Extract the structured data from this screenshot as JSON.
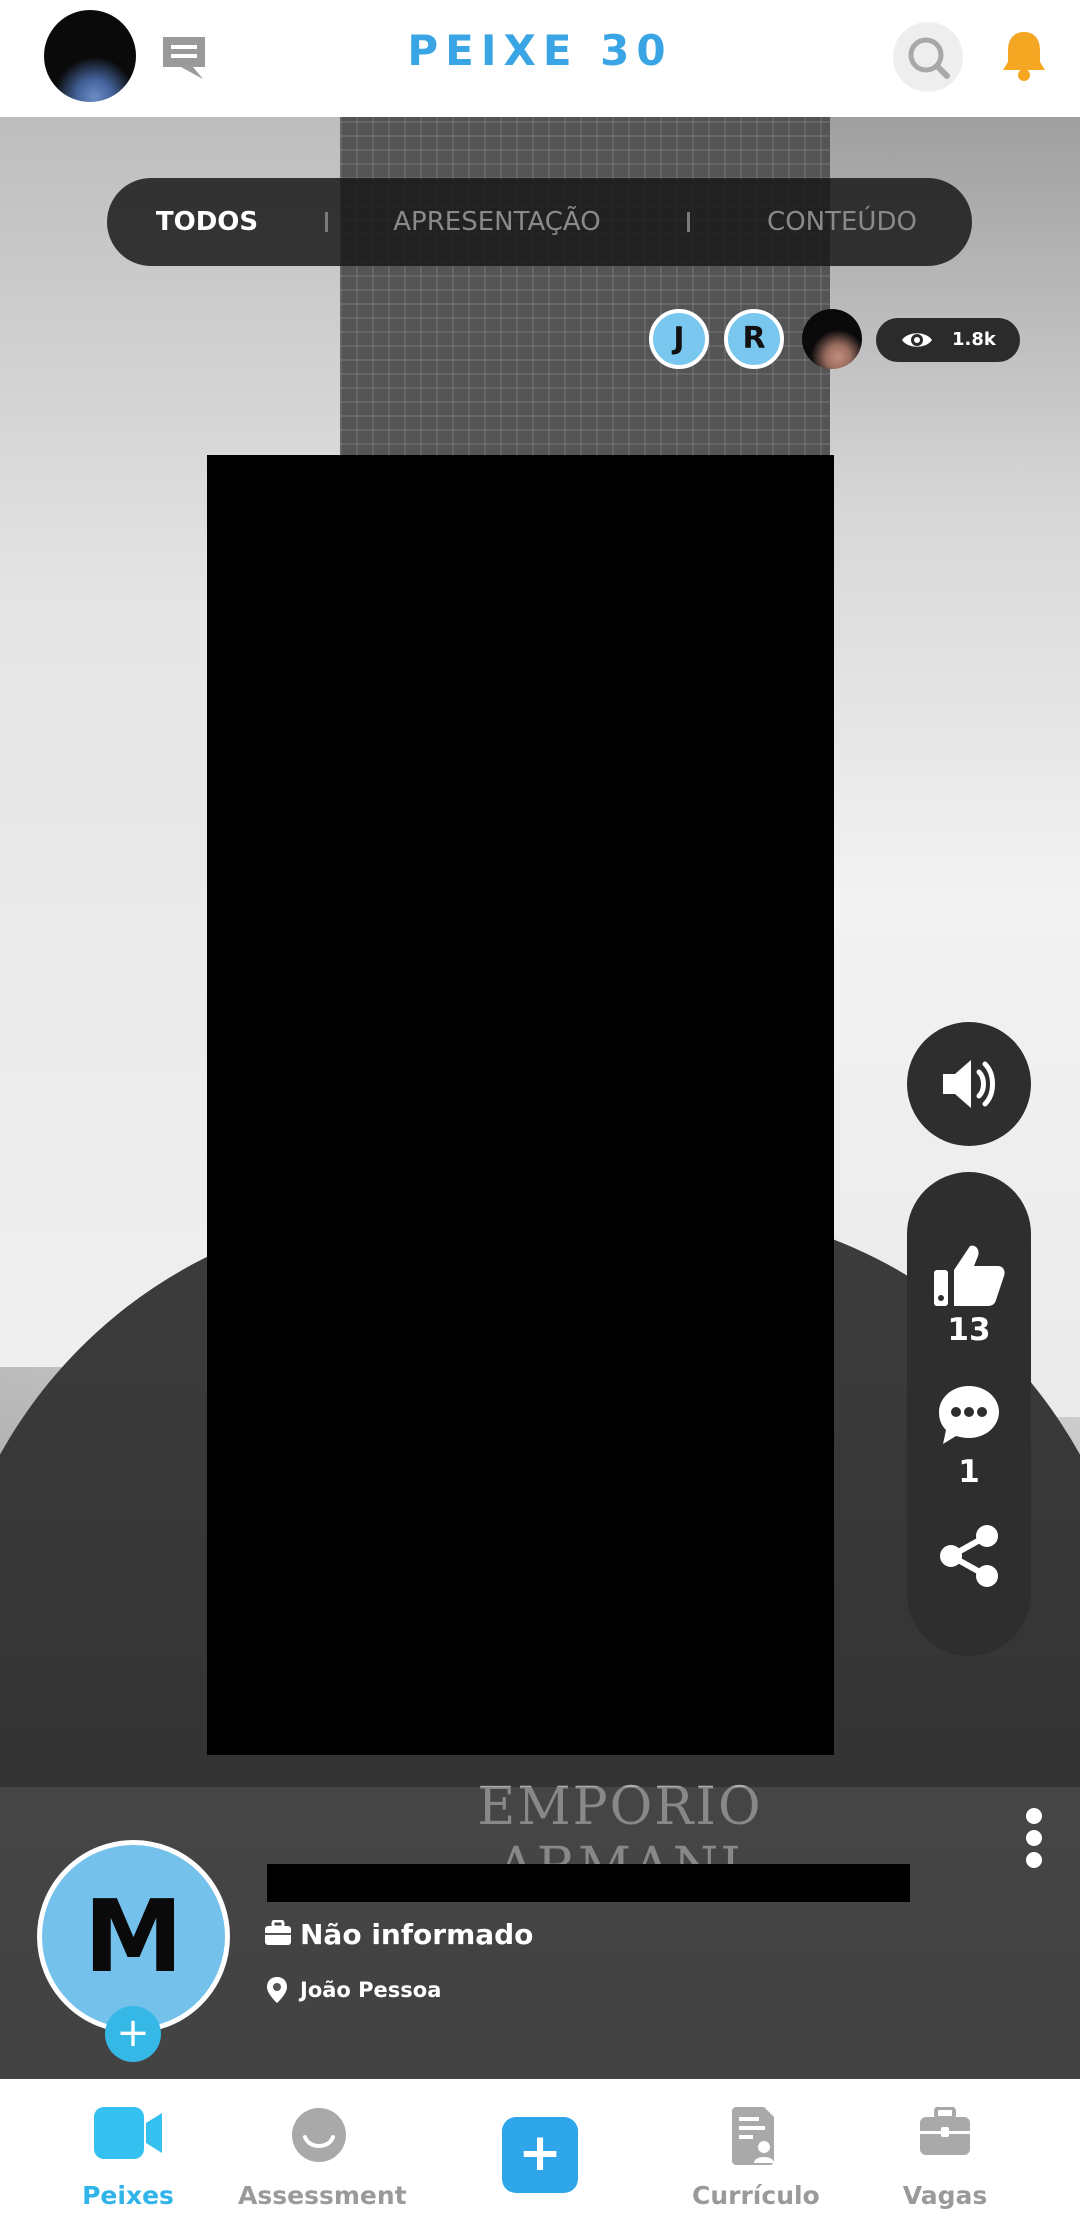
{
  "header": {
    "brand": "PEIXE 30"
  },
  "filters": {
    "tabs": [
      {
        "label": "TODOS",
        "active": true
      },
      {
        "label": "APRESENTAÇÃO",
        "active": false
      },
      {
        "label": "CONTEÚDO",
        "active": false
      }
    ]
  },
  "viewers": {
    "avatars": [
      "J",
      "R"
    ],
    "views": "1.8k"
  },
  "video": {
    "shirt_print": "EMPORIO ARMANI"
  },
  "actions": {
    "likes": "13",
    "comments": "1"
  },
  "profile": {
    "initial": "M",
    "job": "Não informado",
    "location": "João Pessoa"
  },
  "nav": {
    "items": [
      {
        "label": "Peixes",
        "icon": "video-camera-icon",
        "active": true
      },
      {
        "label": "Assessment",
        "icon": "smiley-icon",
        "active": false
      },
      {
        "label": "+",
        "icon": "plus-icon",
        "active": false
      },
      {
        "label": "Currículo",
        "icon": "resume-icon",
        "active": false
      },
      {
        "label": "Vagas",
        "icon": "briefcase-icon",
        "active": false
      }
    ]
  },
  "colors": {
    "brand": "#3aa5e4",
    "accent": "#2fb3e8",
    "bell": "#f5a623",
    "avatar_bg": "#74c1ec"
  }
}
